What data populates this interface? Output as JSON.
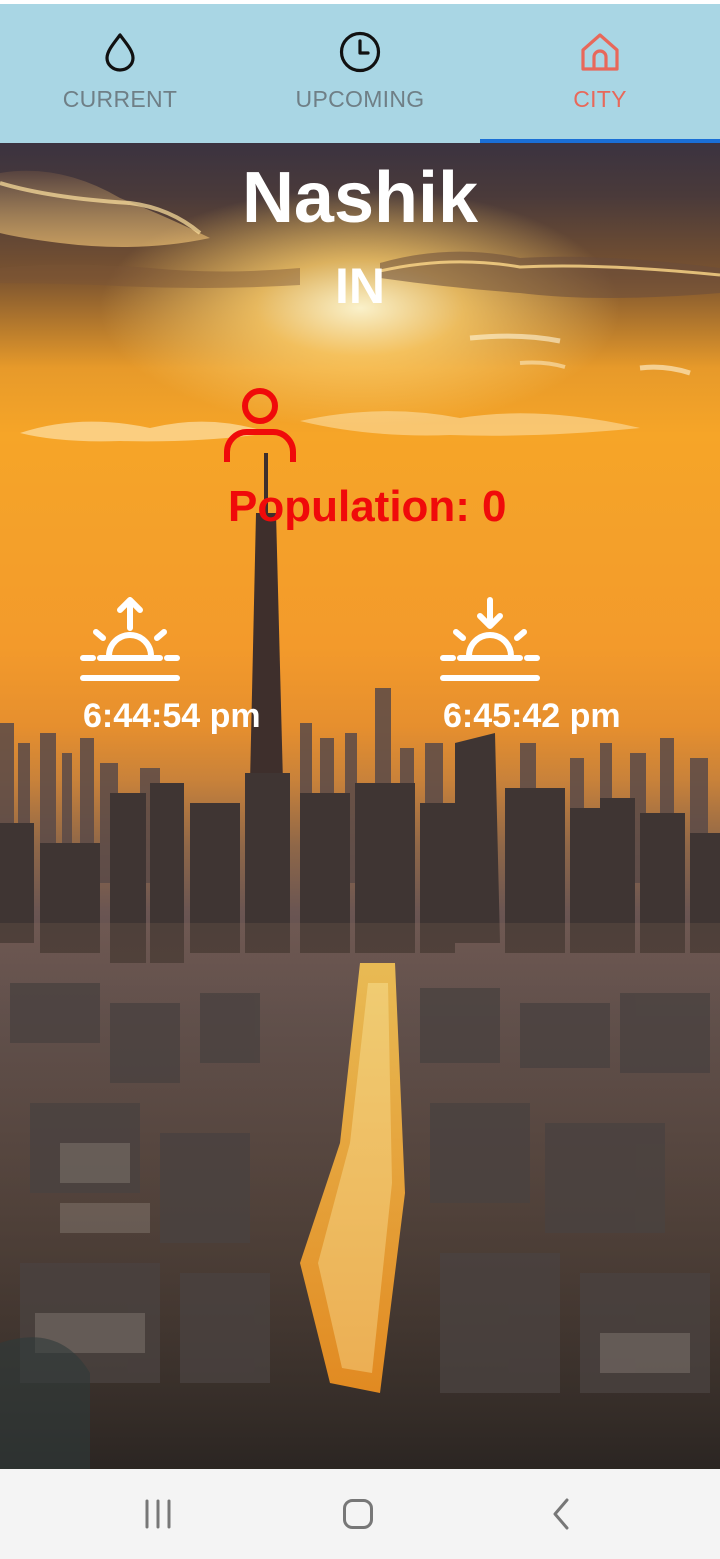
{
  "tabs": [
    {
      "label": "CURRENT",
      "icon": "water-drop-icon",
      "active": false
    },
    {
      "label": "UPCOMING",
      "icon": "clock-icon",
      "active": false
    },
    {
      "label": "CITY",
      "icon": "home-icon",
      "active": true
    }
  ],
  "colors": {
    "tabbar_bg": "#a9d6e4",
    "tab_inactive": "#6f7f86",
    "tab_active": "#e8685a",
    "indicator": "#1a6fd6",
    "population": "#f00a0a",
    "text_light": "#ffffff",
    "navbar_bg": "#f4f4f4"
  },
  "city": {
    "name": "Nashik",
    "country": "IN",
    "population_label": "Population:",
    "population_value": "0",
    "population_icon": "person-icon",
    "sunrise_icon": "sunrise-icon",
    "sunrise_time": "6:44:54 pm",
    "sunset_icon": "sunset-icon",
    "sunset_time": "6:45:42 pm"
  },
  "navbar": {
    "recent": "recent-apps-icon",
    "home": "home-button-icon",
    "back": "back-icon"
  }
}
